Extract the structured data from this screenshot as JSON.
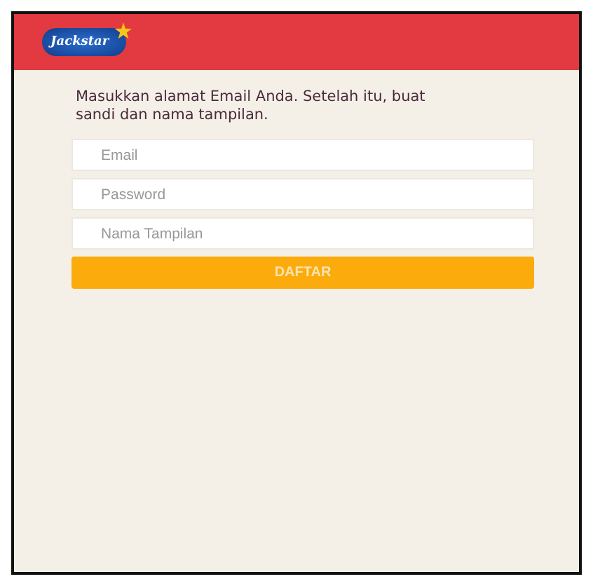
{
  "header": {
    "logo_text": "Jackstar"
  },
  "instructions": "Masukkan alamat Email Anda. Setelah itu, buat sandi dan nama tampilan.",
  "fields": [
    {
      "placeholder": "Email"
    },
    {
      "placeholder": "Password"
    },
    {
      "placeholder": "Nama Tampilan"
    }
  ],
  "submit_button": "DAFTAR"
}
